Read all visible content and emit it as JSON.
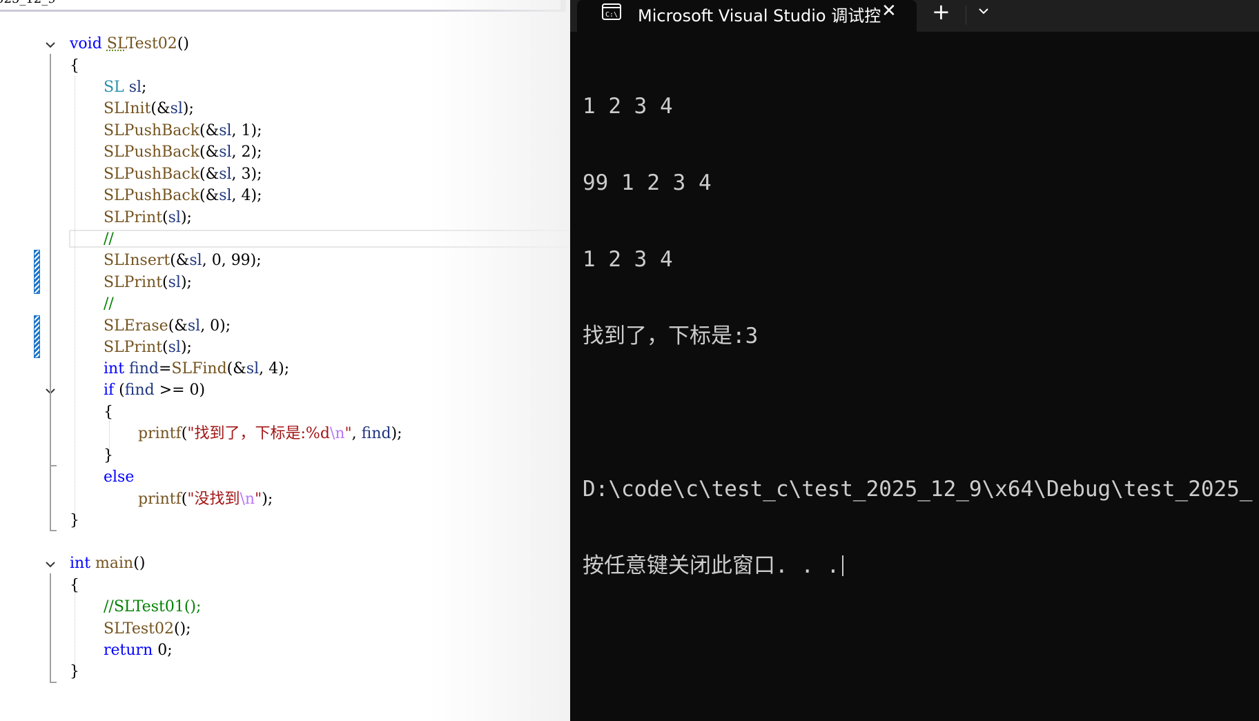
{
  "editor": {
    "tab_fragment": "025_12_9",
    "code_lines": [
      {
        "tokens": [
          [
            "kw",
            "void"
          ],
          [
            "pl",
            " "
          ],
          [
            "fn squig",
            "SL"
          ],
          [
            "fn",
            "Test02"
          ],
          [
            "pl",
            "()"
          ]
        ]
      },
      {
        "tokens": [
          [
            "pl",
            "{"
          ]
        ]
      },
      {
        "tokens": [
          [
            "ty",
            "SL"
          ],
          [
            "pl",
            " "
          ],
          [
            "var",
            "sl"
          ],
          [
            "pl",
            ";"
          ]
        ]
      },
      {
        "tokens": [
          [
            "fn",
            "SLInit"
          ],
          [
            "pl",
            "(&"
          ],
          [
            "var",
            "sl"
          ],
          [
            "pl",
            ");"
          ]
        ]
      },
      {
        "tokens": [
          [
            "fn",
            "SLPushBack"
          ],
          [
            "pl",
            "(&"
          ],
          [
            "var",
            "sl"
          ],
          [
            "pl",
            ", 1);"
          ]
        ]
      },
      {
        "tokens": [
          [
            "fn",
            "SLPushBack"
          ],
          [
            "pl",
            "(&"
          ],
          [
            "var",
            "sl"
          ],
          [
            "pl",
            ", 2);"
          ]
        ]
      },
      {
        "tokens": [
          [
            "fn",
            "SLPushBack"
          ],
          [
            "pl",
            "(&"
          ],
          [
            "var",
            "sl"
          ],
          [
            "pl",
            ", 3);"
          ]
        ]
      },
      {
        "tokens": [
          [
            "fn",
            "SLPushBack"
          ],
          [
            "pl",
            "(&"
          ],
          [
            "var",
            "sl"
          ],
          [
            "pl",
            ", 4);"
          ]
        ]
      },
      {
        "tokens": [
          [
            "fn",
            "SLPrint"
          ],
          [
            "pl",
            "("
          ],
          [
            "var",
            "sl"
          ],
          [
            "pl",
            ");"
          ]
        ]
      },
      {
        "tokens": [
          [
            "cm",
            "//"
          ]
        ]
      },
      {
        "tokens": [
          [
            "fn",
            "SLInsert"
          ],
          [
            "pl",
            "(&"
          ],
          [
            "var",
            "sl"
          ],
          [
            "pl",
            ", 0, 99);"
          ]
        ]
      },
      {
        "tokens": [
          [
            "fn",
            "SLPrint"
          ],
          [
            "pl",
            "("
          ],
          [
            "var",
            "sl"
          ],
          [
            "pl",
            ");"
          ]
        ]
      },
      {
        "tokens": [
          [
            "cm",
            "//"
          ]
        ]
      },
      {
        "tokens": [
          [
            "fn",
            "SLErase"
          ],
          [
            "pl",
            "(&"
          ],
          [
            "var",
            "sl"
          ],
          [
            "pl",
            ", 0);"
          ]
        ]
      },
      {
        "tokens": [
          [
            "fn",
            "SLPrint"
          ],
          [
            "pl",
            "("
          ],
          [
            "var",
            "sl"
          ],
          [
            "pl",
            ");"
          ]
        ]
      },
      {
        "tokens": [
          [
            "kw",
            "int"
          ],
          [
            "pl",
            " "
          ],
          [
            "var",
            "find"
          ],
          [
            "pl",
            "="
          ],
          [
            "fn",
            "SLFind"
          ],
          [
            "pl",
            "(&"
          ],
          [
            "var",
            "sl"
          ],
          [
            "pl",
            ", 4);"
          ]
        ]
      },
      {
        "tokens": [
          [
            "kw",
            "if"
          ],
          [
            "pl",
            " ("
          ],
          [
            "var",
            "find"
          ],
          [
            "pl",
            " >= 0)"
          ]
        ]
      },
      {
        "tokens": [
          [
            "pl",
            "{"
          ]
        ]
      },
      {
        "tokens": [
          [
            "fn",
            "printf"
          ],
          [
            "pl",
            "("
          ],
          [
            "str",
            "\"找到了，下标是:%d"
          ],
          [
            "esc",
            "\\n"
          ],
          [
            "str",
            "\""
          ],
          [
            "pl",
            ", "
          ],
          [
            "var",
            "find"
          ],
          [
            "pl",
            ");"
          ]
        ]
      },
      {
        "tokens": [
          [
            "pl",
            "}"
          ]
        ]
      },
      {
        "tokens": [
          [
            "kw",
            "else"
          ]
        ]
      },
      {
        "tokens": [
          [
            "fn",
            "printf"
          ],
          [
            "pl",
            "("
          ],
          [
            "str",
            "\"没找到"
          ],
          [
            "esc",
            "\\n"
          ],
          [
            "str",
            "\""
          ],
          [
            "pl",
            ");"
          ]
        ]
      },
      {
        "tokens": [
          [
            "pl",
            "}"
          ]
        ]
      },
      {
        "tokens": []
      },
      {
        "tokens": [
          [
            "kw",
            "int"
          ],
          [
            "pl",
            " "
          ],
          [
            "fn",
            "main"
          ],
          [
            "pl",
            "()"
          ]
        ]
      },
      {
        "tokens": [
          [
            "pl",
            "{"
          ]
        ]
      },
      {
        "tokens": [
          [
            "cm",
            "//SLTest01();"
          ]
        ]
      },
      {
        "tokens": [
          [
            "fn",
            "SLTest02"
          ],
          [
            "pl",
            "();"
          ]
        ]
      },
      {
        "tokens": [
          [
            "kw",
            "return"
          ],
          [
            "pl",
            " 0;"
          ]
        ]
      },
      {
        "tokens": [
          [
            "pl",
            "}"
          ]
        ]
      }
    ]
  },
  "console": {
    "tab_title": "Microsoft Visual Studio 调试控",
    "close_glyph": "✕",
    "new_tab_glyph": "+",
    "output_lines": [
      "1 2 3 4",
      "99 1 2 3 4",
      "1 2 3 4",
      "找到了，下标是:3",
      "",
      "D:\\code\\c\\test_c\\test_2025_12_9\\x64\\Debug\\test_2025_",
      "按任意键关闭此窗口. . ."
    ]
  },
  "colors": {
    "keyword": "#0000ff",
    "type": "#2b91af",
    "function": "#74531f",
    "variable": "#1f377f",
    "string": "#a31515",
    "escape": "#b776fb",
    "comment": "#008000",
    "console_bg": "#0c0c0c",
    "console_fg": "#cccccc"
  }
}
